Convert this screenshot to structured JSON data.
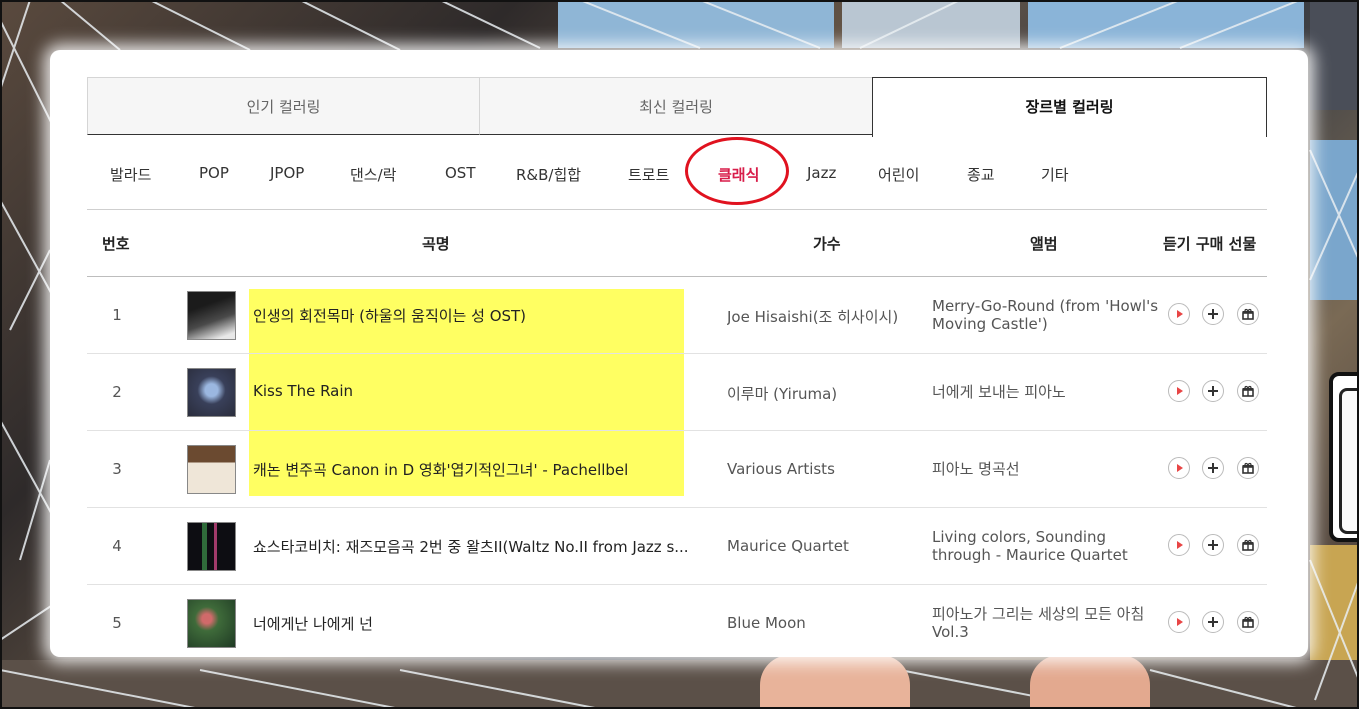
{
  "tabs": [
    "인기 컬러링",
    "최신 컬러링",
    "장르별 컬러링"
  ],
  "genres": [
    "발라드",
    "POP",
    "JPOP",
    "댄스/락",
    "OST",
    "R&B/힙합",
    "트로트",
    "클래식",
    "Jazz",
    "어린이",
    "종교",
    "기타"
  ],
  "active_genre": "클래식",
  "table": {
    "headers": {
      "number": "번호",
      "title": "곡명",
      "artist": "가수",
      "album": "앨범",
      "actions": "듣기 구매 선물"
    },
    "rows": [
      {
        "number": "1",
        "title": "인생의 회전목마 (하울의 움직이는 성 OST)",
        "artist": "Joe Hisaishi(조 히사이시)",
        "album": "Merry-Go-Round (from 'Howl's Moving Castle')"
      },
      {
        "number": "2",
        "title": "Kiss The Rain",
        "artist": "이루마 (Yiruma)",
        "album": "너에게 보내는 피아노"
      },
      {
        "number": "3",
        "title": "캐논 변주곡 Canon in D 영화'엽기적인그녀' - Pachellbel",
        "artist": "Various Artists",
        "album": "피아노 명곡선"
      },
      {
        "number": "4",
        "title": "쇼스타코비치: 재즈모음곡 2번 중 왈츠II(Waltz No.II from Jazz s...",
        "artist": "Maurice Quartet",
        "album": "Living colors, Sounding through - Maurice Quartet"
      },
      {
        "number": "5",
        "title": "너에게난 나에게 넌",
        "artist": "Blue Moon",
        "album": "피아노가 그리는 세상의 모든 아침 Vol.3"
      }
    ]
  },
  "colors": {
    "active_genre": "#d81d4a",
    "annotation_circle": "#e0121f",
    "highlight": "#ffff5a",
    "play_icon": "#e84545"
  }
}
